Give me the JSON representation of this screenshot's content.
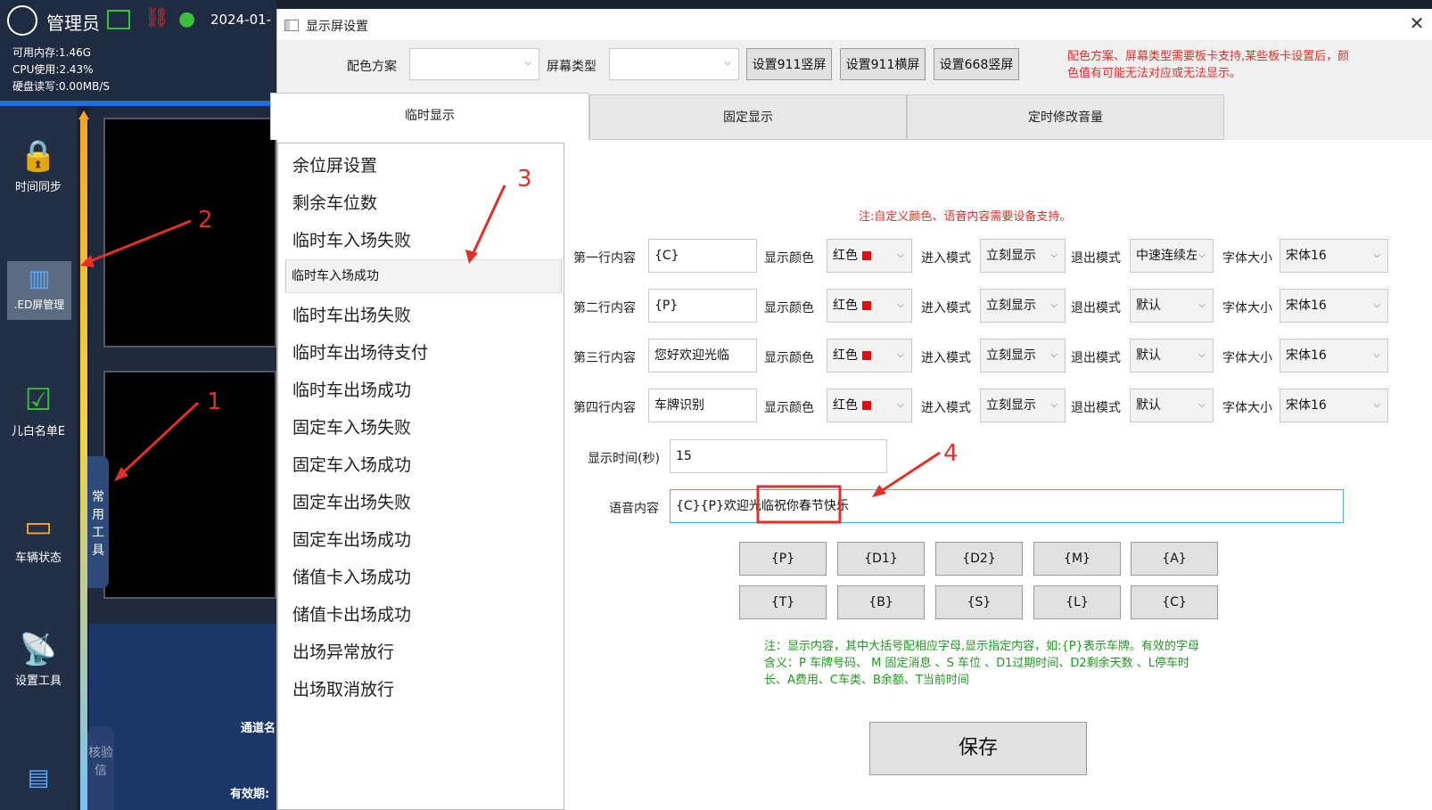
{
  "background_app": {
    "user": "管理员",
    "date": "2024-01-",
    "stats": [
      "可用内存:1.46G",
      "CPU使用:2.43%",
      "硬盘读写:0.00MB/S"
    ],
    "sidebar": [
      {
        "label": "时间同步",
        "icon": "lock-clock-icon"
      },
      {
        "label": ".ED屏管理",
        "icon": "led-panel-icon"
      },
      {
        "label": "儿白名单E",
        "icon": "clipboard-check-icon"
      },
      {
        "label": "车辆状态",
        "icon": "card-icon"
      },
      {
        "label": "设置工具",
        "icon": "broadcast-icon"
      }
    ],
    "tools_label": "常用工具",
    "verify_label": "核验信",
    "channel_label": "通道名",
    "valid_label": "有效期:"
  },
  "dialog": {
    "title": "显示屏设置",
    "close": "✕",
    "toolbar": {
      "scheme_label": "配色方案",
      "scheme_value": "",
      "screen_type_label": "屏幕类型",
      "screen_type_value": "",
      "btn_911_vertical": "设置911竖屏",
      "btn_911_horizontal": "设置911横屏",
      "btn_668_vertical": "设置668竖屏",
      "note": "配色方案、屏幕类型需要板卡支持,某些板卡设置后，颜色值有可能无法对应或无法显示。"
    },
    "tabs": [
      "临时显示",
      "固定显示",
      "定时修改音量"
    ],
    "list_items": [
      "余位屏设置",
      "剩余车位数",
      "临时车入场失败",
      "临时车入场成功",
      "临时车出场失败",
      "临时车出场待支付",
      "临时车出场成功",
      "固定车入场失败",
      "固定车入场成功",
      "固定车出场失败",
      "固定车出场成功",
      "储值卡入场成功",
      "储值卡出场成功",
      "出场异常放行",
      "出场取消放行"
    ],
    "selected_index": 3,
    "custom_note": "注:自定义颜色、语音内容需要设备支持。",
    "field_labels": {
      "color": "显示颜色",
      "enter": "进入模式",
      "exit": "退出模式",
      "font": "字体大小"
    },
    "rows": [
      {
        "label": "第一行内容",
        "content": "{C}",
        "color": "红色",
        "enter": "立刻显示",
        "exit": "中速连续左",
        "font": "宋体16"
      },
      {
        "label": "第二行内容",
        "content": "{P}",
        "color": "红色",
        "enter": "立刻显示",
        "exit": "默认",
        "font": "宋体16"
      },
      {
        "label": "第三行内容",
        "content": "您好欢迎光临",
        "color": "红色",
        "enter": "立刻显示",
        "exit": "默认",
        "font": "宋体16"
      },
      {
        "label": "第四行内容",
        "content": "车牌识别",
        "color": "红色",
        "enter": "立刻显示",
        "exit": "默认",
        "font": "宋体16"
      }
    ],
    "display_time_label": "显示时间(秒)",
    "display_time_value": "15",
    "voice_label": "语音内容",
    "voice_value": "{C}{P}欢迎光临祝你春节快乐",
    "code_buttons": [
      [
        "{P}",
        "{D1}",
        "{D2}",
        "{M}",
        "{A}"
      ],
      [
        "{T}",
        "{B}",
        "{S}",
        "{L}",
        "{C}"
      ]
    ],
    "help_note": "注：显示内容，其中大括号配相应字母,显示指定内容，如:{P}表示车牌。有效的字母含义：P 车牌号码、 M 固定消息 、S 车位 、D1过期时间、D2剩余天数 、L停车时长、A费用、C车类、B余额、T当前时间",
    "save": "保存"
  },
  "annotations": [
    "1",
    "2",
    "3",
    "4"
  ],
  "colors": {
    "accent_red": "#e0302a",
    "note_green": "#1d9a1d",
    "swatch_red": "#e01010"
  }
}
